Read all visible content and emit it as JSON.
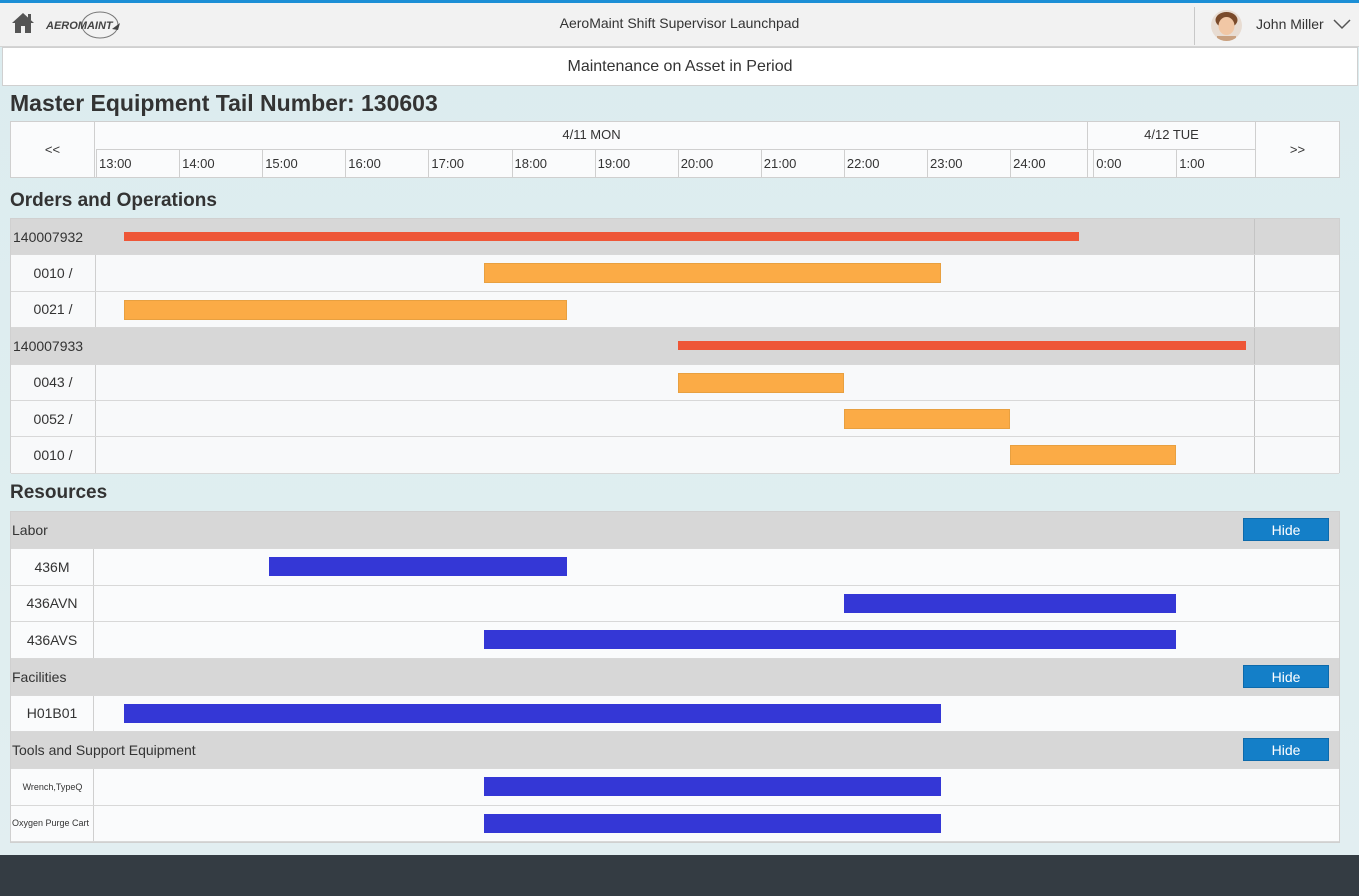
{
  "shell": {
    "title": "AeroMaint Shift Supervisor Launchpad",
    "user_name": "John Miller",
    "logo_text": "AEROMAINT",
    "accent": "#1c8fd6"
  },
  "page": {
    "subheader": "Maintenance on Asset in Period",
    "master_title": "Master Equipment Tail Number: 130603"
  },
  "timeline": {
    "prev_label": "<<",
    "next_label": ">>",
    "days": [
      {
        "label": "4/11 MON"
      },
      {
        "label": "4/12 TUE"
      }
    ],
    "hours": [
      "13:00",
      "14:00",
      "15:00",
      "16:00",
      "17:00",
      "18:00",
      "19:00",
      "20:00",
      "21:00",
      "22:00",
      "23:00",
      "24:00",
      "0:00",
      "1:00"
    ]
  },
  "orders_section": {
    "title": "Orders and Operations",
    "rows": [
      {
        "label": "140007932",
        "kind": "order",
        "start": "13:20",
        "end": "24:50",
        "color": "#ee5637"
      },
      {
        "label": "0010 /",
        "kind": "operation",
        "start": "17:40",
        "end": "23:10",
        "color": "#fbab46"
      },
      {
        "label": "0021 /",
        "kind": "operation",
        "start": "13:20",
        "end": "18:40",
        "color": "#fbab46"
      },
      {
        "label": "140007933",
        "kind": "order",
        "start": "20:00",
        "end": "26:50",
        "color": "#ee5637"
      },
      {
        "label": "0043 /",
        "kind": "operation",
        "start": "20:00",
        "end": "22:00",
        "color": "#fbab46"
      },
      {
        "label": "0052 /",
        "kind": "operation",
        "start": "22:00",
        "end": "24:00",
        "color": "#fbab46"
      },
      {
        "label": "0010 /",
        "kind": "operation",
        "start": "24:00",
        "end": "26:00",
        "color": "#fbab46"
      }
    ]
  },
  "resources_section": {
    "title": "Resources",
    "bar_color": "#3437d6",
    "groups": [
      {
        "label": "Labor",
        "hide_label": "Hide",
        "items": [
          {
            "label": "436M",
            "start": "15:05",
            "end": "18:40"
          },
          {
            "label": "436AVN",
            "start": "22:00",
            "end": "26:00"
          },
          {
            "label": "436AVS",
            "start": "17:40",
            "end": "26:00"
          }
        ]
      },
      {
        "label": "Facilities",
        "hide_label": "Hide",
        "items": [
          {
            "label": "H01B01",
            "start": "13:20",
            "end": "23:10"
          }
        ]
      },
      {
        "label": "Tools and Support Equipment",
        "hide_label": "Hide",
        "items": [
          {
            "label": "Wrench,TypeQ",
            "start": "17:40",
            "end": "23:10"
          },
          {
            "label": "Oxygen Purge Cart",
            "start": "17:40",
            "end": "23:10"
          }
        ]
      }
    ]
  }
}
